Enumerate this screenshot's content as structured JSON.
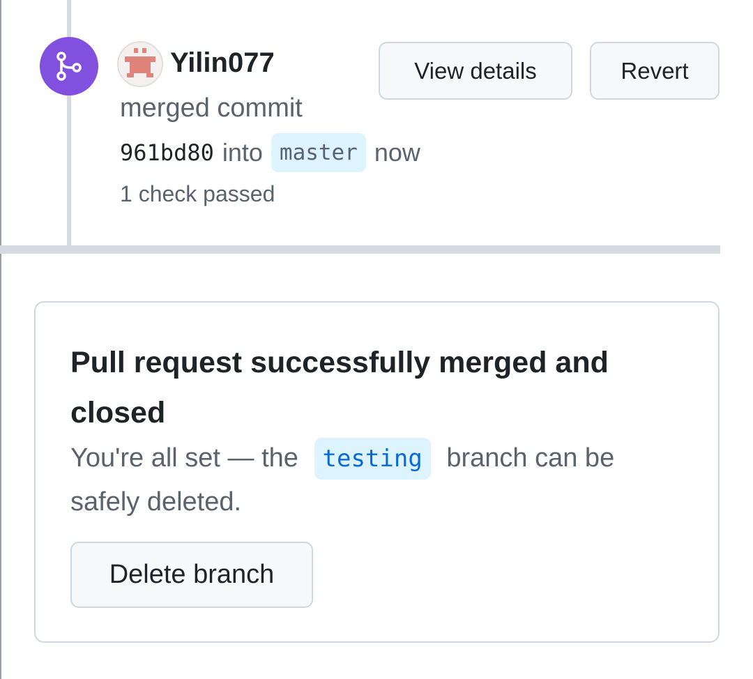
{
  "timeline_event": {
    "username": "Yilin077",
    "action_text": "merged commit",
    "commit_sha": "961bd80",
    "into_text": "into",
    "target_branch": "master",
    "time_text": "now",
    "check_status": "1 check passed",
    "view_details_label": "View details",
    "revert_label": "Revert",
    "badge_color": "#8250df",
    "badge_icon": "git-merge-icon"
  },
  "merged_card": {
    "title": "Pull request successfully merged and closed",
    "desc_prefix": "You're all set — the",
    "branch_name": "testing",
    "desc_suffix": "branch can be safely deleted.",
    "delete_button_label": "Delete branch"
  }
}
